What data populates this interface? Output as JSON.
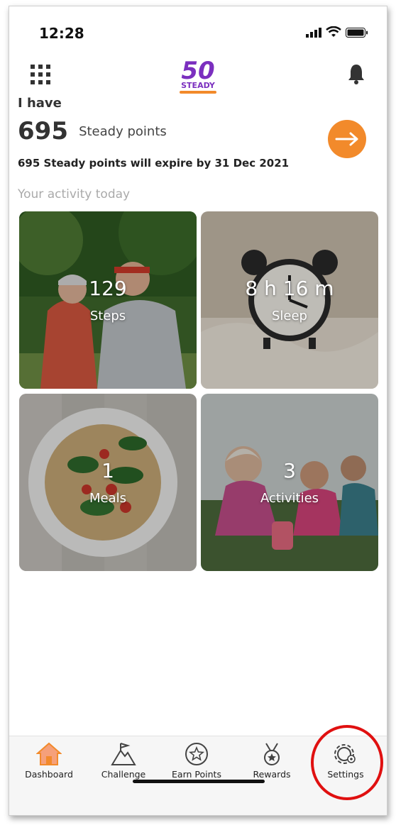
{
  "status": {
    "time": "12:28"
  },
  "logo": {
    "number": "50",
    "word": "STEADY"
  },
  "header": {
    "intro": "I have",
    "points": "695",
    "points_label": "Steady points",
    "expiry": "695 Steady points will expire by 31 Dec 2021"
  },
  "activity": {
    "title": "Your activity today",
    "tiles": [
      {
        "value": "129",
        "label": "Steps"
      },
      {
        "value": "8 h 16 m",
        "label": "Sleep"
      },
      {
        "value": "1",
        "label": "Meals"
      },
      {
        "value": "3",
        "label": "Activities"
      }
    ]
  },
  "tabs": [
    {
      "label": "Dashboard",
      "icon": "home-icon",
      "active": true
    },
    {
      "label": "Challenge",
      "icon": "mountain-flag-icon"
    },
    {
      "label": "Earn Points",
      "icon": "star-circle-icon"
    },
    {
      "label": "Rewards",
      "icon": "medal-icon"
    },
    {
      "label": "Settings",
      "icon": "gear-icon"
    }
  ],
  "colors": {
    "accent": "#f28a2b",
    "brand_purple": "#7b2fbf",
    "highlight": "#e01010"
  }
}
